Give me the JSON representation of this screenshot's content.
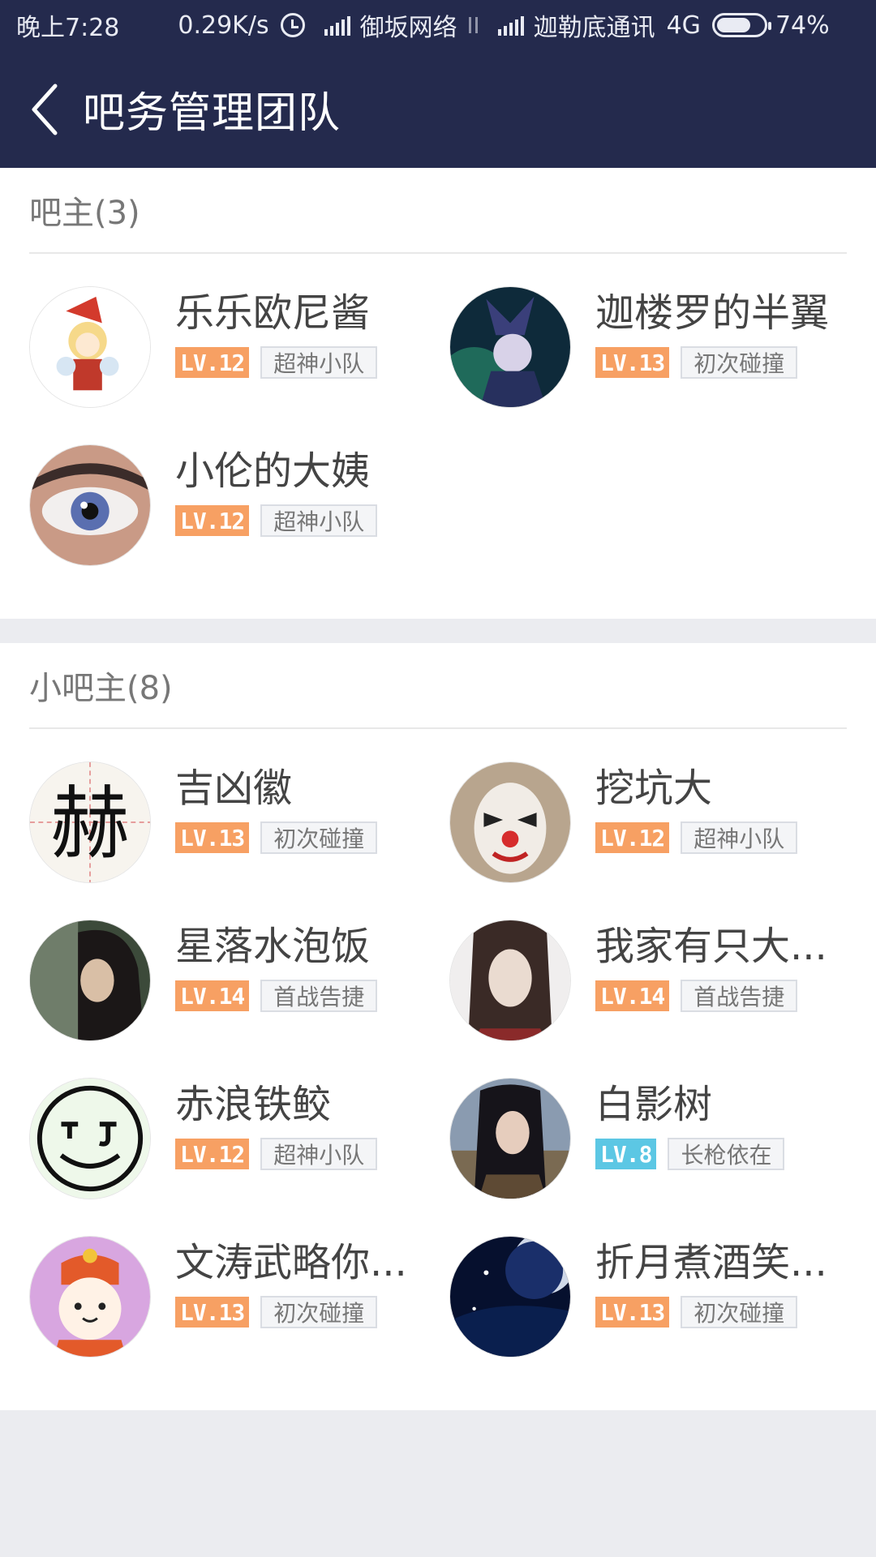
{
  "status_bar": {
    "time": "晚上7:28",
    "speed": "0.29K/s",
    "carrier1": "御坂网络",
    "carrier2": "迦勒底通讯",
    "network": "4G",
    "battery": "74%",
    "battery_level": 0.74,
    "icons": [
      "alarm-icon",
      "signal-icon",
      "data-arrows-icon",
      "battery-icon"
    ]
  },
  "header": {
    "title": "吧务管理团队",
    "back_icon": "chevron-left-icon"
  },
  "sections": [
    {
      "title": "吧主(3)",
      "members": [
        {
          "name": "乐乐欧尼酱",
          "level": "LV.12",
          "tag": "超神小队",
          "level_color": "#f7a063"
        },
        {
          "name": "迦楼罗的半翼",
          "level": "LV.13",
          "tag": "初次碰撞",
          "level_color": "#f7a063"
        },
        {
          "name": "小伦的大姨",
          "level": "LV.12",
          "tag": "超神小队",
          "level_color": "#f7a063"
        }
      ]
    },
    {
      "title": "小吧主(8)",
      "members": [
        {
          "name": "吉凶徽",
          "level": "LV.13",
          "tag": "初次碰撞",
          "level_color": "#f7a063"
        },
        {
          "name": "挖坑大",
          "level": "LV.12",
          "tag": "超神小队",
          "level_color": "#f7a063"
        },
        {
          "name": "星落水泡饭",
          "level": "LV.14",
          "tag": "首战告捷",
          "level_color": "#f7a063"
        },
        {
          "name": "我家有只大...",
          "level": "LV.14",
          "tag": "首战告捷",
          "level_color": "#f7a063"
        },
        {
          "name": "赤浪铁鲛",
          "level": "LV.12",
          "tag": "超神小队",
          "level_color": "#f7a063"
        },
        {
          "name": "白影树",
          "level": "LV.8",
          "tag": "长枪依在",
          "level_color": "#5cc7e4"
        },
        {
          "name": "文涛武略你...",
          "level": "LV.13",
          "tag": "初次碰撞",
          "level_color": "#f7a063"
        },
        {
          "name": "折月煮酒笑...",
          "level": "LV.13",
          "tag": "初次碰撞",
          "level_color": "#f7a063"
        }
      ]
    }
  ],
  "colors": {
    "header_bg": "#242a4d",
    "level_orange": "#f7a063",
    "level_blue": "#5cc7e4",
    "page_bg": "#ebecf0"
  }
}
